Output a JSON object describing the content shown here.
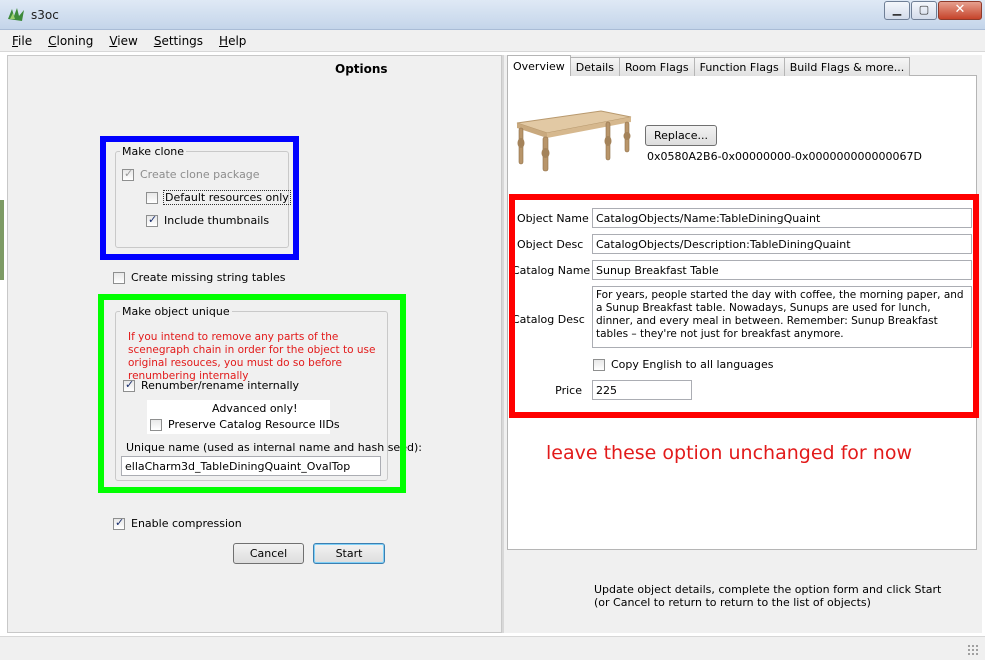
{
  "window": {
    "title": "s3oc"
  },
  "menu": [
    "File",
    "Cloning",
    "View",
    "Settings",
    "Help"
  ],
  "options_label": "Options",
  "make_clone": {
    "legend": "Make clone",
    "create_clone_package": {
      "label": "Create clone package",
      "checked": true,
      "disabled": true
    },
    "default_resources_only": {
      "label": "Default resources only",
      "checked": false
    },
    "include_thumbnails": {
      "label": "Include thumbnails",
      "checked": true
    }
  },
  "create_missing_string_tables": {
    "label": "Create missing string tables",
    "checked": false
  },
  "make_unique": {
    "legend": "Make object unique",
    "warning": "If you intend to remove any parts of the scenegraph chain in order for the object to use original resouces, you must do so before renumbering internally",
    "renumber": {
      "label": "Renumber/rename internally",
      "checked": true
    },
    "advanced_label": "Advanced only!",
    "preserve_iids": {
      "label": "Preserve Catalog Resource IIDs",
      "checked": false
    },
    "unique_name_label": "Unique name (used as internal name and hash seed):",
    "unique_name_value": "ellaCharm3d_TableDiningQuaint_OvalTop"
  },
  "enable_compression": {
    "label": "Enable compression",
    "checked": true
  },
  "buttons": {
    "cancel": "Cancel",
    "start": "Start"
  },
  "tabs": [
    "Overview",
    "Details",
    "Room Flags",
    "Function Flags",
    "Build Flags & more..."
  ],
  "overview": {
    "replace_button": "Replace...",
    "iid": "0x0580A2B6-0x00000000-0x000000000000067D",
    "object_name_label": "Object Name",
    "object_name": "CatalogObjects/Name:TableDiningQuaint",
    "object_desc_label": "Object Desc",
    "object_desc": "CatalogObjects/Description:TableDiningQuaint",
    "catalog_name_label": "Catalog Name",
    "catalog_name": "Sunup Breakfast Table",
    "catalog_desc_label": "Catalog Desc",
    "catalog_desc": "For years, people started the day with coffee,  the morning paper, and a Sunup Breakfast table. Nowadays, Sunups are used for lunch, dinner, and every meal in between. Remember: Sunup Breakfast tables – they're not just for breakfast anymore.",
    "copy_english": {
      "label": "Copy English to all languages",
      "checked": false
    },
    "price_label": "Price",
    "price": "225"
  },
  "annotation_note": "leave these option unchanged for now",
  "status": {
    "line1": "Update object details, complete the option form and click Start",
    "line2": "(or Cancel to return to return to the list of objects)"
  },
  "colors": {
    "blue_frame": "#0000ff",
    "green_frame": "#00ff00",
    "red_frame": "#ff0000",
    "warning_text": "#e21a1a"
  }
}
